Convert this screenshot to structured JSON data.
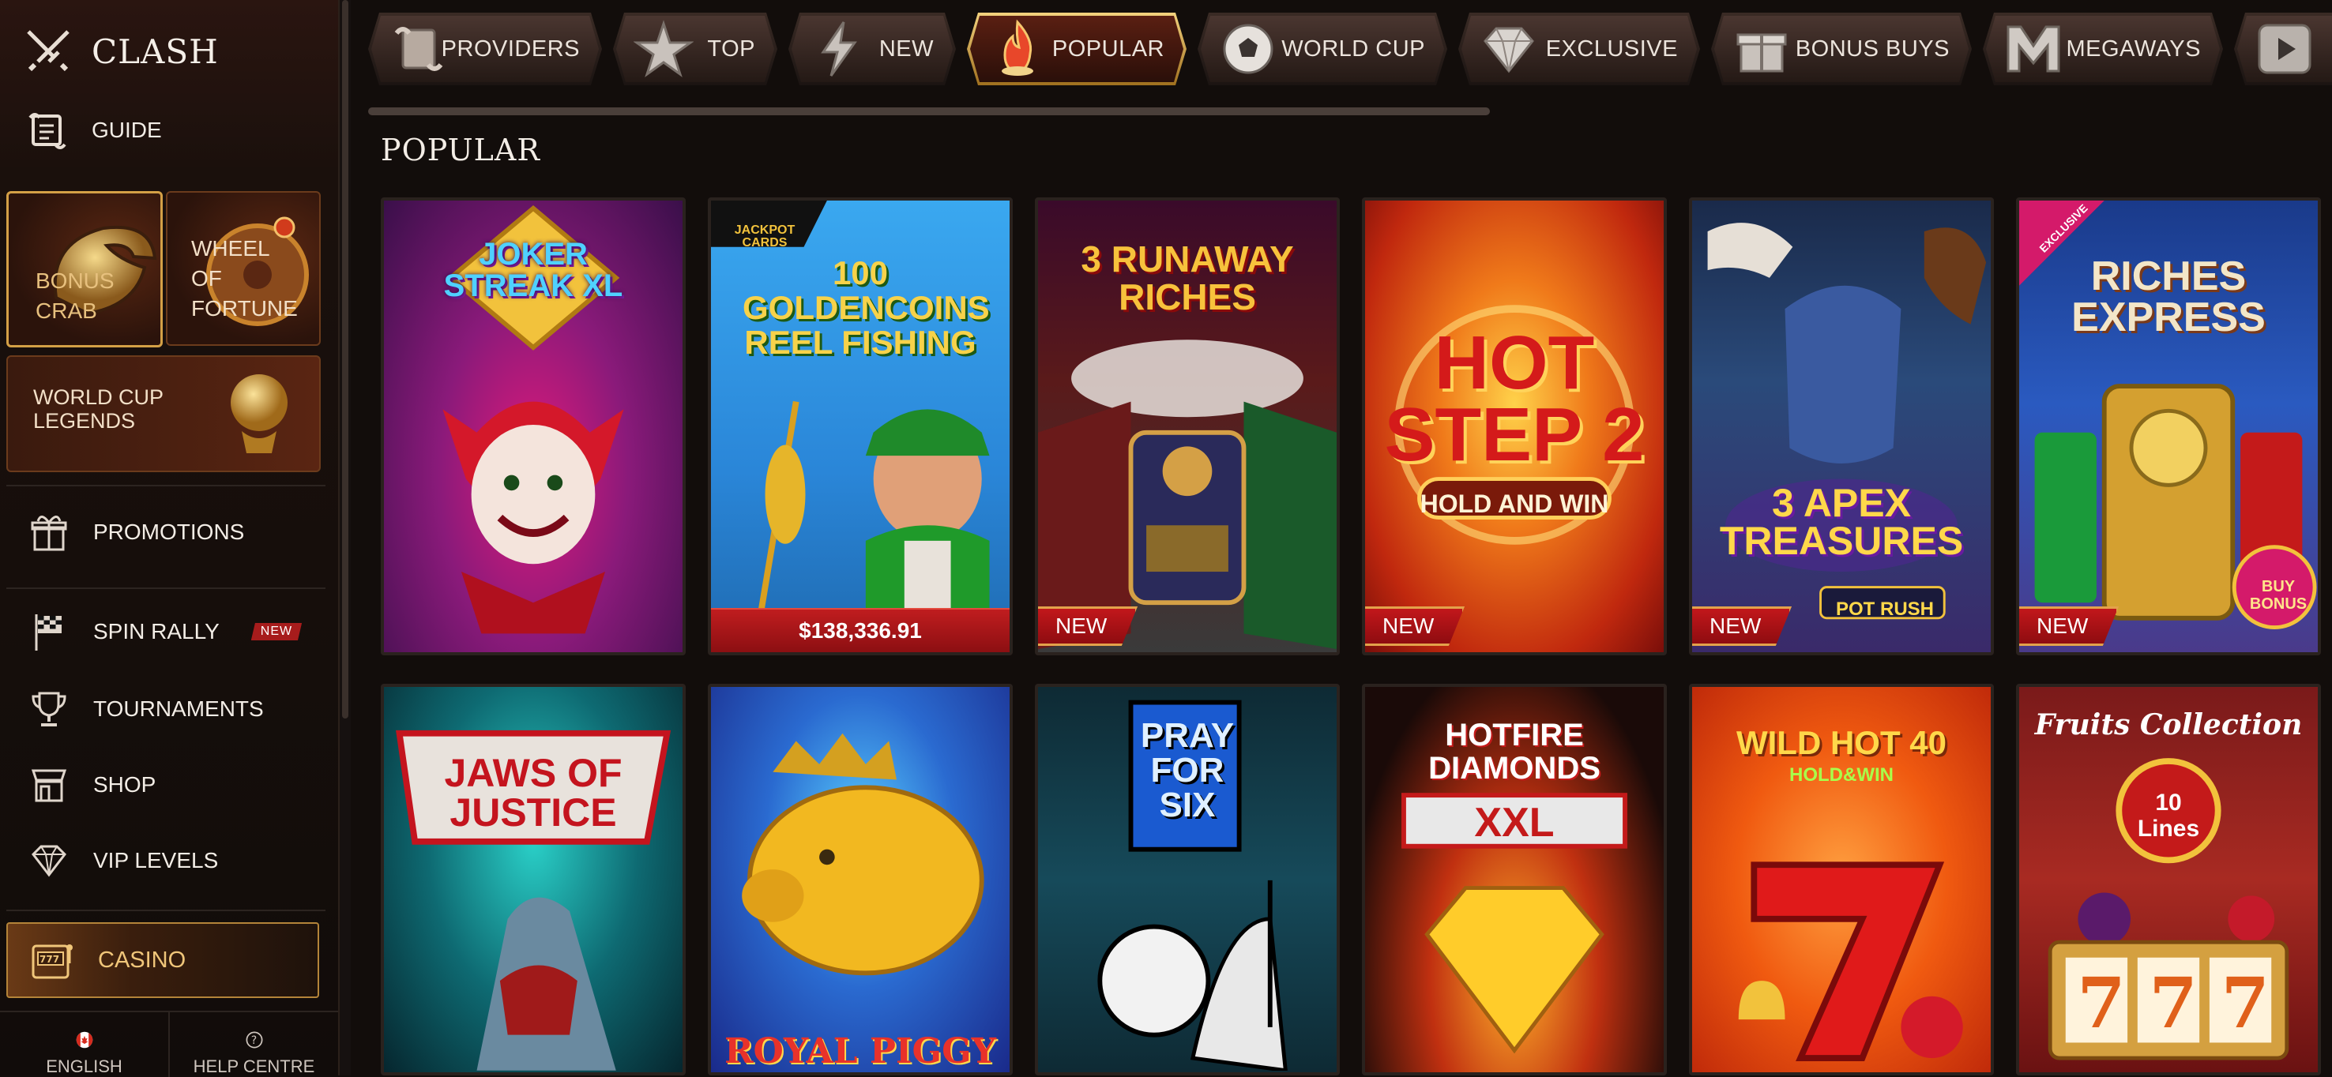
{
  "sidebar": {
    "brand": "CLASH",
    "guide": "GUIDE",
    "tiles": {
      "bonus_crab": "BONUS CRAB",
      "wheel_of_fortune": "WHEEL OF FORTUNE",
      "world_cup_legends": "WORLD CUP LEGENDS"
    },
    "nav": [
      {
        "label": "PROMOTIONS",
        "icon": "gift-icon"
      },
      {
        "label": "SPIN RALLY",
        "icon": "checkered-flag-icon",
        "badge": "NEW"
      },
      {
        "label": "TOURNAMENTS",
        "icon": "trophy-icon"
      },
      {
        "label": "SHOP",
        "icon": "shop-icon"
      },
      {
        "label": "VIP LEVELS",
        "icon": "diamond-icon"
      }
    ],
    "casino": "CASINO",
    "bottom": {
      "language": "ENGLISH",
      "help": "HELP CENTRE"
    }
  },
  "categories": [
    {
      "label": "PROVIDERS",
      "icon": "scroll-icon"
    },
    {
      "label": "TOP",
      "icon": "star-icon"
    },
    {
      "label": "NEW",
      "icon": "lightning-icon"
    },
    {
      "label": "POPULAR",
      "icon": "flame-icon",
      "active": true
    },
    {
      "label": "WORLD CUP",
      "icon": "football-icon"
    },
    {
      "label": "EXCLUSIVE",
      "icon": "diamond-icon"
    },
    {
      "label": "BONUS BUYS",
      "icon": "gift-icon"
    },
    {
      "label": "MEGAWAYS",
      "icon": "m-icon"
    },
    {
      "label": "",
      "icon": "play-icon"
    }
  ],
  "section_title": "POPULAR",
  "games_row1": [
    {
      "title": "JOKER STREAK XL"
    },
    {
      "title": "100 GOLDENCOINS REEL FISHING",
      "corner": "JACKPOT CARDS",
      "jackpot": "$138,336.91"
    },
    {
      "title": "3 RUNAWAY RICHES",
      "badge": "NEW"
    },
    {
      "title": "HOT STEP 2",
      "subtitle": "HOLD AND WIN",
      "badge": "NEW"
    },
    {
      "title": "3 APEX TREASURES",
      "subtitle": "POT RUSH",
      "badge": "NEW"
    },
    {
      "title": "RICHES EXPRESS",
      "ribbon": "EXCLUSIVE",
      "stamp": "BUY BONUS",
      "badge": "NEW"
    }
  ],
  "games_row2": [
    {
      "title": "JAWS OF JUSTICE"
    },
    {
      "title": "ROYAL PIGGY"
    },
    {
      "title": "PRAY FOR SIX"
    },
    {
      "title": "HOTFIRE DIAMONDS",
      "subtitle": "XXL"
    },
    {
      "title": "WILD HOT 40",
      "subtitle": "HOLD&WIN"
    },
    {
      "title": "Fruits Collection",
      "subtitle": "10 Lines"
    }
  ],
  "colors": {
    "accent_gold": "#d4a046",
    "badge_red": "#c2171b",
    "background": "#120d0b"
  }
}
